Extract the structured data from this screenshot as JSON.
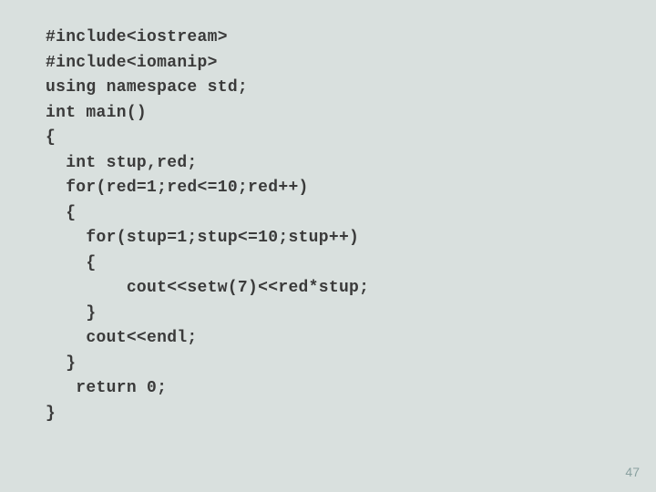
{
  "code": {
    "l01": "#include<iostream>",
    "l02": "#include<iomanip>",
    "l03": "using namespace std;",
    "l04": "int main()",
    "l05": "{",
    "l06": "  int stup,red;",
    "l07": "  for(red=1;red<=10;red++)",
    "l08": "  {",
    "l09": "    for(stup=1;stup<=10;stup++)",
    "l10": "    {",
    "l11": "        cout<<setw(7)<<red*stup;",
    "l12": "    }",
    "l13": "    cout<<endl;",
    "l14": "  }",
    "l15": "   return 0;",
    "l16": "}"
  },
  "page_number": "47"
}
